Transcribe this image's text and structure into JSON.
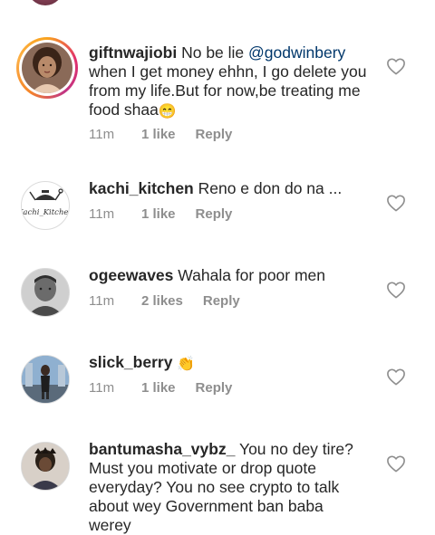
{
  "comments": [
    {
      "username": "giftnwajiobi",
      "text_before": " No be lie ",
      "mention": "@godwinbery",
      "text_after": " when I get money ehhn, I go delete you from my life.But for now,be treating me food shaa",
      "emoji": "😁",
      "time": "11m",
      "likes": "1 like",
      "reply": "Reply"
    },
    {
      "username": "kachi_kitchen",
      "text": " Reno e don do na ...",
      "avatar_text": "Kachi_Kitchen",
      "time": "11m",
      "likes": "1 like",
      "reply": "Reply"
    },
    {
      "username": "ogeewaves",
      "text": " Wahala for poor men",
      "time": "11m",
      "likes": "2 likes",
      "reply": "Reply"
    },
    {
      "username": "slick_berry",
      "emoji": "👏",
      "time": "11m",
      "likes": "1 like",
      "reply": "Reply"
    },
    {
      "username": "bantumasha_vybz_",
      "text": " You no dey tire? Must you motivate or drop quote everyday? You no see crypto to talk about wey Government ban baba werey"
    }
  ],
  "colors": {
    "mention": "#00376b",
    "meta": "#8e8e8e",
    "text": "#262626"
  }
}
